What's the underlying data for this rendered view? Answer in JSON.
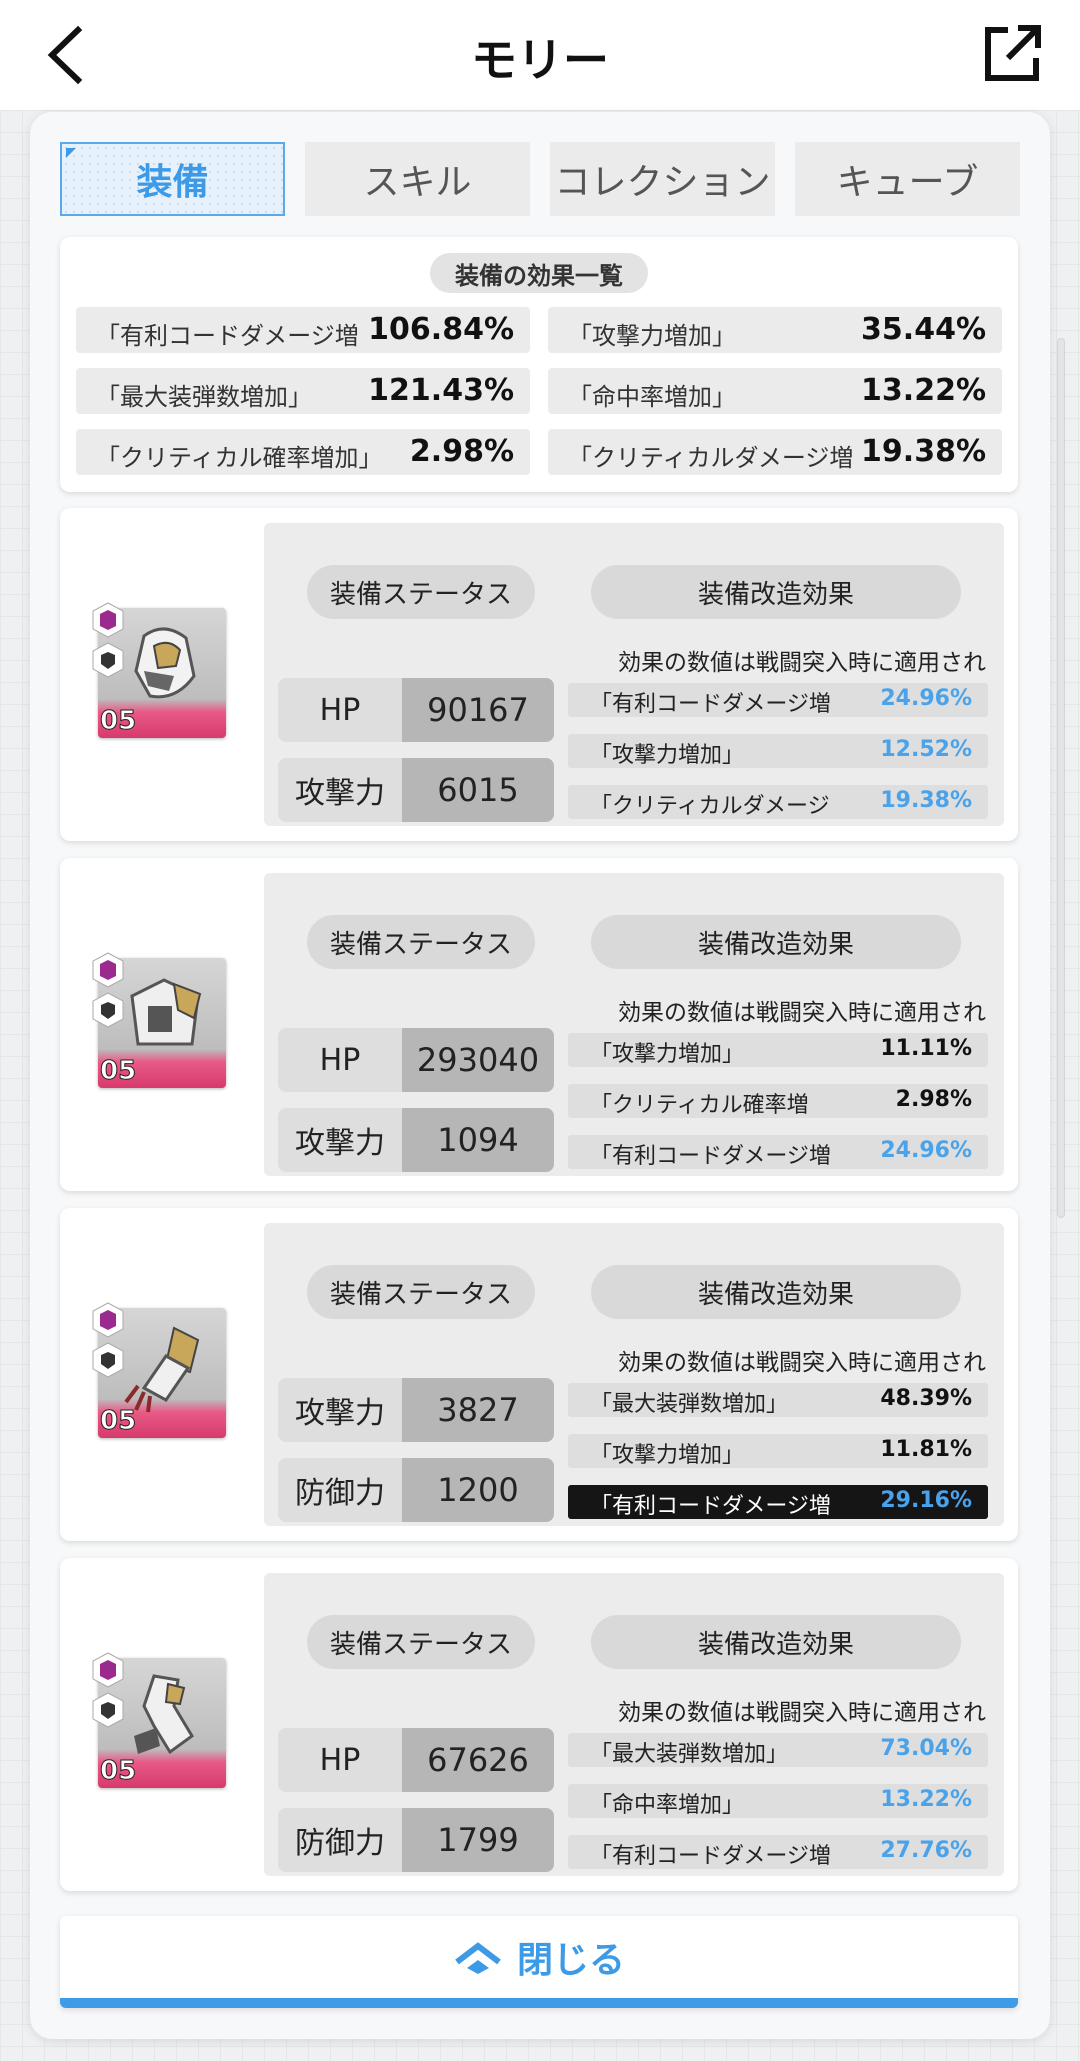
{
  "header": {
    "title": "モリー"
  },
  "tabs": [
    {
      "label": "装備",
      "active": true
    },
    {
      "label": "スキル",
      "active": false
    },
    {
      "label": "コレクション",
      "active": false
    },
    {
      "label": "キューブ",
      "active": false
    }
  ],
  "summary": {
    "title": "装備の効果一覧",
    "items": [
      {
        "label": "「有利コードダメージ増",
        "value": "106.84%"
      },
      {
        "label": "「攻撃力増加」",
        "value": "35.44%"
      },
      {
        "label": "「最大装弾数増加」",
        "value": "121.43%"
      },
      {
        "label": "「命中率増加」",
        "value": "13.22%"
      },
      {
        "label": "「クリティカル確率増加」",
        "value": "2.98%"
      },
      {
        "label": "「クリティカルダメージ増",
        "value": "19.38%"
      }
    ]
  },
  "equipment": [
    {
      "level": "05",
      "status_label": "装備ステータス",
      "mod_label": "装備改造効果",
      "note": "効果の数値は戦闘突入時に適用され",
      "stats": [
        {
          "label": "HP",
          "value": "90167"
        },
        {
          "label": "攻撃力",
          "value": "6015"
        }
      ],
      "effects": [
        {
          "label": "「有利コードダメージ増",
          "value": "24.96%",
          "color": "#4aa3ea"
        },
        {
          "label": "「攻撃力増加」",
          "value": "12.52%",
          "color": "#4aa3ea"
        },
        {
          "label": "「クリティカルダメージ",
          "value": "19.38%",
          "color": "#4aa3ea"
        }
      ]
    },
    {
      "level": "05",
      "status_label": "装備ステータス",
      "mod_label": "装備改造効果",
      "note": "効果の数値は戦闘突入時に適用され",
      "stats": [
        {
          "label": "HP",
          "value": "293040"
        },
        {
          "label": "攻撃力",
          "value": "1094"
        }
      ],
      "effects": [
        {
          "label": "「攻撃力増加」",
          "value": "11.11%",
          "color": "#111111"
        },
        {
          "label": "「クリティカル確率増",
          "value": "2.98%",
          "color": "#111111"
        },
        {
          "label": "「有利コードダメージ増",
          "value": "24.96%",
          "color": "#4aa3ea"
        }
      ]
    },
    {
      "level": "05",
      "status_label": "装備ステータス",
      "mod_label": "装備改造効果",
      "note": "効果の数値は戦闘突入時に適用され",
      "stats": [
        {
          "label": "攻撃力",
          "value": "3827"
        },
        {
          "label": "防御力",
          "value": "1200"
        }
      ],
      "effects": [
        {
          "label": "「最大装弾数増加」",
          "value": "48.39%",
          "color": "#111111"
        },
        {
          "label": "「攻撃力増加」",
          "value": "11.81%",
          "color": "#111111"
        },
        {
          "label": "「有利コードダメージ増",
          "value": "29.16%",
          "color": "#4aa3ea",
          "highlight": true
        }
      ]
    },
    {
      "level": "05",
      "status_label": "装備ステータス",
      "mod_label": "装備改造効果",
      "note": "効果の数値は戦闘突入時に適用され",
      "stats": [
        {
          "label": "HP",
          "value": "67626"
        },
        {
          "label": "防御力",
          "value": "1799"
        }
      ],
      "effects": [
        {
          "label": "「最大装弾数増加」",
          "value": "73.04%",
          "color": "#4aa3ea"
        },
        {
          "label": "「命中率増加」",
          "value": "13.22%",
          "color": "#4aa3ea"
        },
        {
          "label": "「有利コードダメージ増",
          "value": "27.76%",
          "color": "#4aa3ea"
        }
      ]
    }
  ],
  "close": {
    "label": "閉じる"
  },
  "icons": {
    "back": "chevron-left-icon",
    "share": "external-link-icon",
    "close": "double-chevron-up-icon"
  }
}
